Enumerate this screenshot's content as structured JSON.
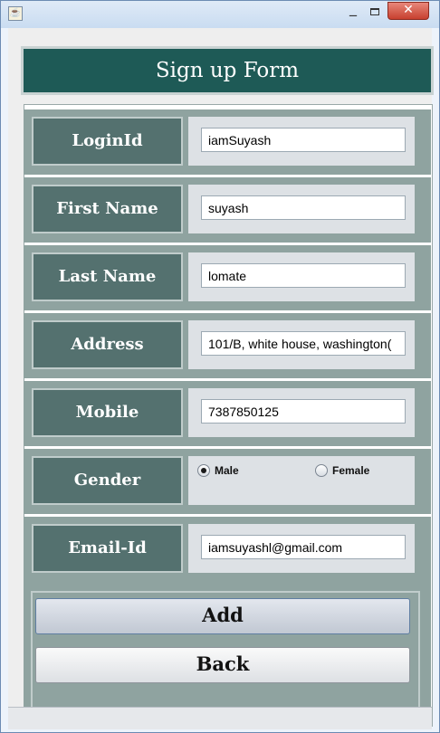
{
  "window": {
    "icon": "java-icon",
    "minimize_icon": "minimize-icon",
    "maximize_icon": "maximize-icon",
    "close_symbol": "✕",
    "title_color": "#1e5a56"
  },
  "form": {
    "title": "Sign up Form",
    "fields": {
      "loginid": {
        "label": "LoginId",
        "value": "iamSuyash"
      },
      "first_name": {
        "label": "First Name",
        "value": "suyash"
      },
      "last_name": {
        "label": "Last Name",
        "value": "lomate"
      },
      "address": {
        "label": "Address",
        "value": "101/B, white house, washington("
      },
      "mobile": {
        "label": "Mobile",
        "value": "7387850125"
      },
      "email": {
        "label": "Email-Id",
        "value": "iamsuyashl@gmail.com"
      }
    },
    "gender": {
      "label": "Gender",
      "options": [
        {
          "label": "Male",
          "selected": true
        },
        {
          "label": "Female",
          "selected": false
        }
      ]
    },
    "buttons": {
      "add": "Add",
      "back": "Back"
    }
  }
}
